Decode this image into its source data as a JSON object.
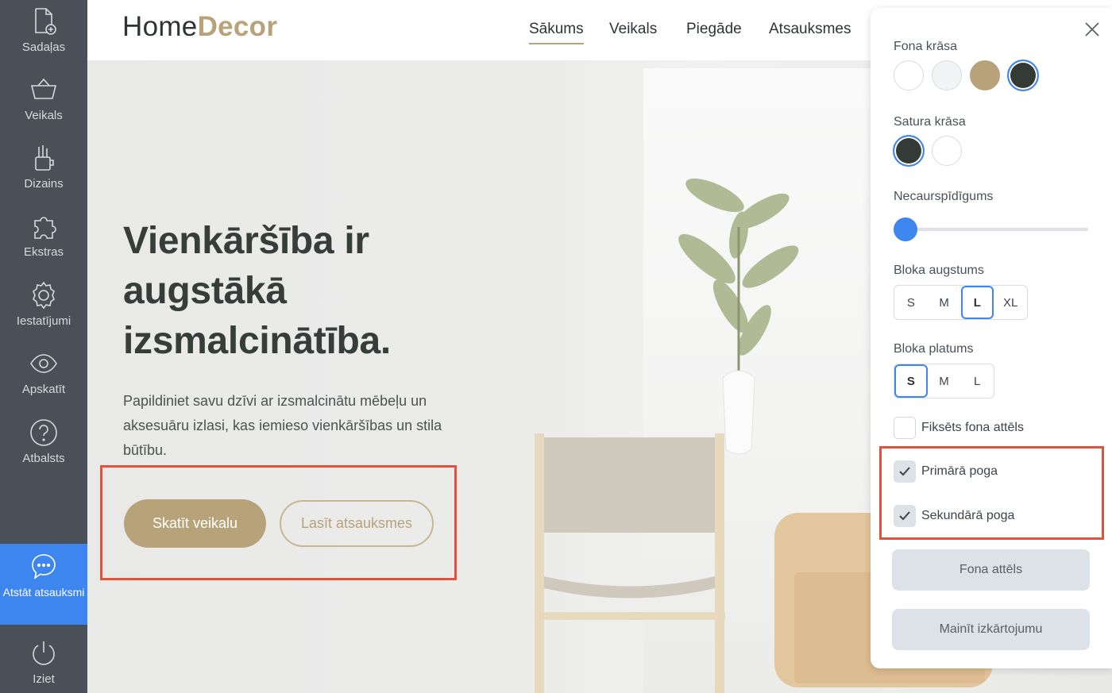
{
  "sidebar": {
    "items": [
      {
        "label": "Sadaļas",
        "icon": "add-page-icon"
      },
      {
        "label": "Veikals",
        "icon": "basket-icon"
      },
      {
        "label": "Dizains",
        "icon": "brush-icon"
      },
      {
        "label": "Ekstras",
        "icon": "puzzle-icon"
      },
      {
        "label": "Iestatījumi",
        "icon": "gear-icon"
      },
      {
        "label": "Apskatīt",
        "icon": "eye-icon"
      },
      {
        "label": "Atbalsts",
        "icon": "help-icon"
      },
      {
        "label": "Atstāt atsauksmi",
        "icon": "chat-bubble-icon"
      },
      {
        "label": "Iziet",
        "icon": "power-icon"
      }
    ]
  },
  "header": {
    "logo_part1": "Home",
    "logo_part2": "Decor",
    "nav": [
      "Sākums",
      "Veikals",
      "Piegāde",
      "Atsauksmes"
    ],
    "active_nav": "Sākums"
  },
  "hero": {
    "headline_lines": [
      "Vienkāršība ir",
      "augstākā",
      "izsmalcinātība."
    ],
    "subtext": "Papildiniet savu dzīvi ar izsmalcinātu mēbeļu un aksesuāru izlasi, kas iemieso vienkāršības un stila būtību.",
    "primary_button": "Skatīt veikalu",
    "secondary_button": "Lasīt atsauksmes"
  },
  "panel": {
    "background_color_label": "Fona krāsa",
    "background_colors": [
      "#ffffff",
      "#f3f4f5",
      "#b8a27a",
      "#343b37"
    ],
    "background_selected": 3,
    "content_color_label": "Satura krāsa",
    "content_colors": [
      "#343b37",
      "#ffffff"
    ],
    "content_selected": 0,
    "opacity_label": "Necaurspīdīgums",
    "opacity_value": 0,
    "height_label": "Bloka augstums",
    "height_options": [
      "S",
      "M",
      "L",
      "XL"
    ],
    "height_selected": "L",
    "width_label": "Bloka platums",
    "width_options": [
      "S",
      "M",
      "L"
    ],
    "width_selected": "S",
    "fixed_bg_label": "Fiksēts fona attēls",
    "fixed_bg_checked": false,
    "primary_button_label": "Primārā poga",
    "primary_button_checked": true,
    "secondary_button_label": "Sekundārā poga",
    "secondary_button_checked": true,
    "bg_image_button": "Fona attēls",
    "change_layout_button": "Mainīt izkārtojumu"
  },
  "colors": {
    "accent": "#3d86f0",
    "brand_gold": "#b8a27a",
    "highlight": "#e0533a",
    "sidebar_bg": "#4a5058"
  }
}
